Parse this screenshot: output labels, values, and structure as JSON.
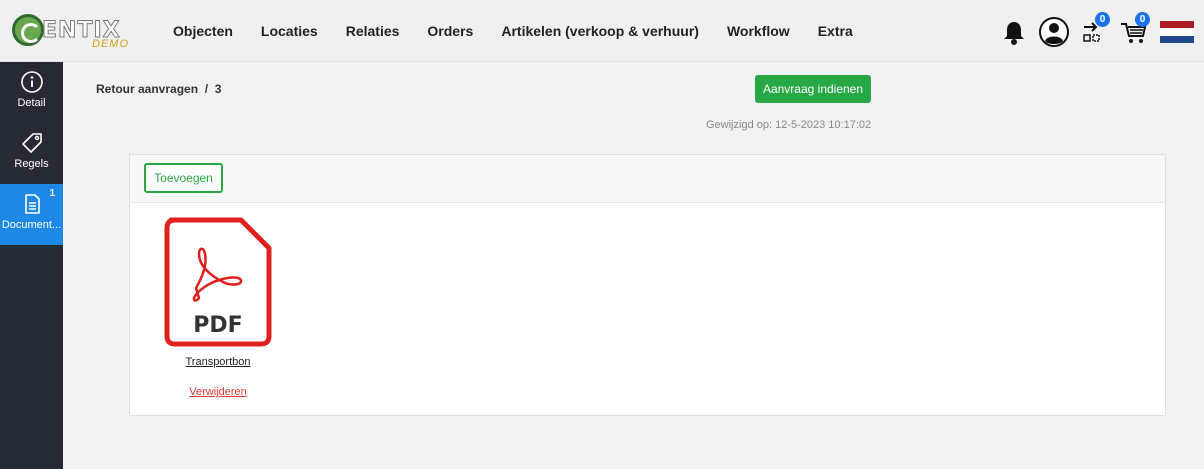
{
  "app": {
    "logo_text": "ENTIX",
    "logo_sub": "DEMO"
  },
  "nav": {
    "items": [
      "Objecten",
      "Locaties",
      "Relaties",
      "Orders",
      "Artikelen (verkoop & verhuur)",
      "Workflow",
      "Extra"
    ]
  },
  "top_icons": {
    "login_badge": "0",
    "cart_badge": "0",
    "flag_colors": [
      "#ae1c28",
      "#ffffff",
      "#21468b"
    ]
  },
  "sidebar": {
    "items": [
      {
        "label": "Detail",
        "icon": "info-icon"
      },
      {
        "label": "Regels",
        "icon": "tag-icon"
      },
      {
        "label": "Document...",
        "icon": "document-icon",
        "badge": "1",
        "active": true
      }
    ]
  },
  "main": {
    "breadcrumb": "Retour aanvragen  /  3",
    "submit_label": "Aanvraag indienen",
    "modified": "Gewijzigd op: 12-5-2023 10:17:02"
  },
  "documents": {
    "add_label": "Toevoegen",
    "items": [
      {
        "type_label": "PDF",
        "name": "Transportbon",
        "delete_label": "Verwijderen"
      }
    ]
  },
  "colors": {
    "accent_green": "#28a745",
    "sidebar_bg": "#262a33",
    "sidebar_active": "#1e88e5",
    "pdf_red": "#e02020",
    "delete_red": "#e53935"
  }
}
